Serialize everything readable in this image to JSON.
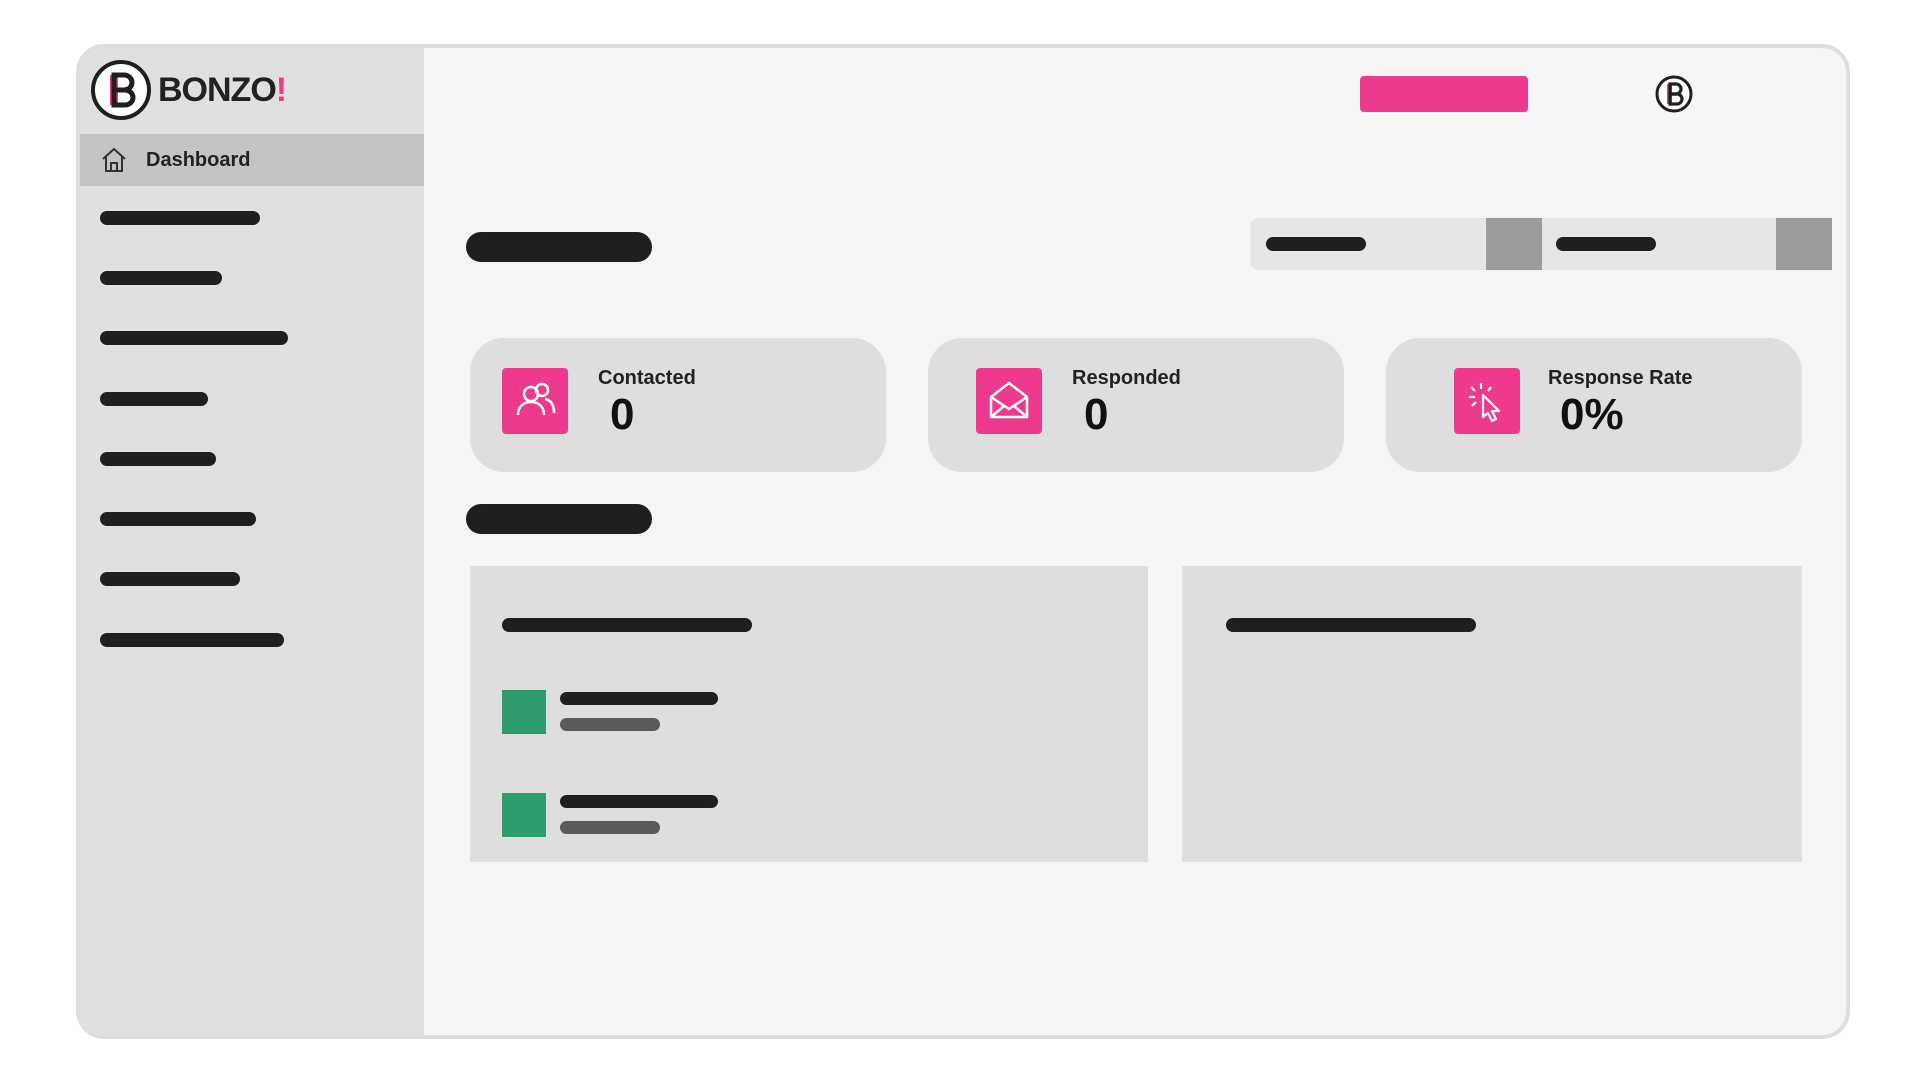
{
  "app": {
    "logo_text": "BONZO",
    "logo_bang": "!",
    "brand_color": "#ee3a8c"
  },
  "sidebar": {
    "active_item": {
      "label": "Dashboard",
      "icon": "home-icon"
    },
    "placeholder_items": 8
  },
  "header": {
    "primary_button_color": "#ee3a8c",
    "avatar_icon": "bonzo-logo-icon"
  },
  "stats": [
    {
      "label": "Contacted",
      "value": "0",
      "icon": "users-icon"
    },
    {
      "label": "Responded",
      "value": "0",
      "icon": "open-envelope-icon"
    },
    {
      "label": "Response Rate",
      "value": "0%",
      "icon": "cursor-click-icon"
    }
  ],
  "colors": {
    "list_swatch": "#2e9d6e",
    "panel_bg": "#dedede",
    "sidebar_bg": "#e0e0e0"
  }
}
